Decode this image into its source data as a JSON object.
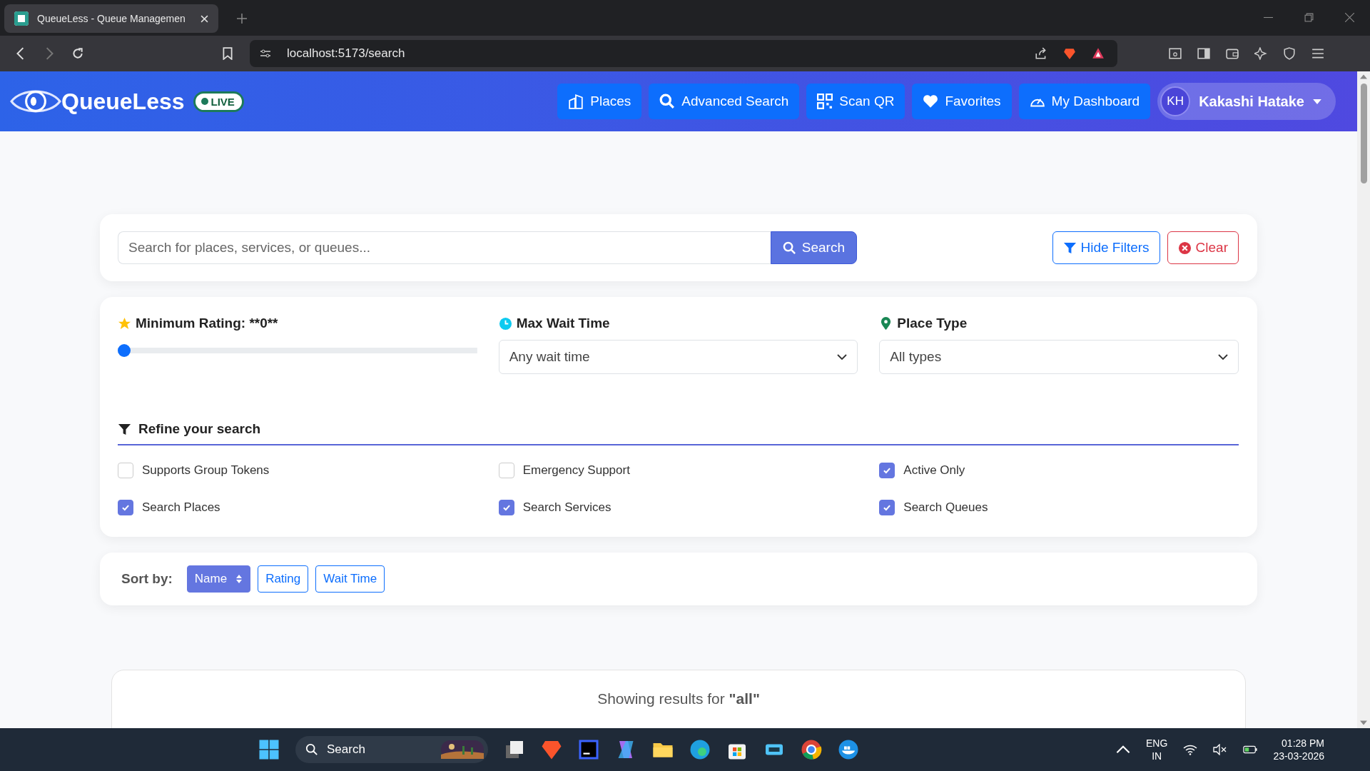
{
  "browser": {
    "tab_title": "QueueLess - Queue Managemen",
    "url": "localhost:5173/search"
  },
  "header": {
    "brand": "QueueLess",
    "live_badge": "LIVE",
    "nav": [
      {
        "kind": "building",
        "label": "Places"
      },
      {
        "kind": "search",
        "label": "Advanced Search"
      },
      {
        "kind": "qr",
        "label": "Scan QR"
      },
      {
        "kind": "heart",
        "label": "Favorites"
      },
      {
        "kind": "gauge",
        "label": "My Dashboard"
      }
    ],
    "user": {
      "initials": "KH",
      "name": "Kakashi Hatake"
    }
  },
  "search": {
    "placeholder": "Search for places, services, or queues...",
    "button": "Search",
    "hide_filters": "Hide Filters",
    "clear": "Clear"
  },
  "filters": {
    "rating_label": "Minimum Rating: **0**",
    "rating": {
      "level": 0
    },
    "wait_label": "Max Wait Time",
    "wait_value": "Any wait time",
    "type_label": "Place Type",
    "type_value": "All types",
    "refine_heading": "Refine your search",
    "options": [
      {
        "label": "Supports Group Tokens",
        "checked": false
      },
      {
        "label": "Emergency Support",
        "checked": false
      },
      {
        "label": "Active Only",
        "checked": true
      },
      {
        "label": "Search Places",
        "checked": true
      },
      {
        "label": "Search Services",
        "checked": true
      },
      {
        "label": "Search Queues",
        "checked": true
      }
    ]
  },
  "sort": {
    "label": "Sort by:",
    "options": [
      {
        "label": "Name",
        "selected": true
      },
      {
        "label": "Rating",
        "selected": false
      },
      {
        "label": "Wait Time",
        "selected": false
      }
    ]
  },
  "results": {
    "heading": "Showing results for **\"all\"**"
  },
  "taskbar": {
    "search": "Search",
    "language": "ENG",
    "region": "IN",
    "time": "01:28 PM",
    "date": "23-03-2026"
  }
}
